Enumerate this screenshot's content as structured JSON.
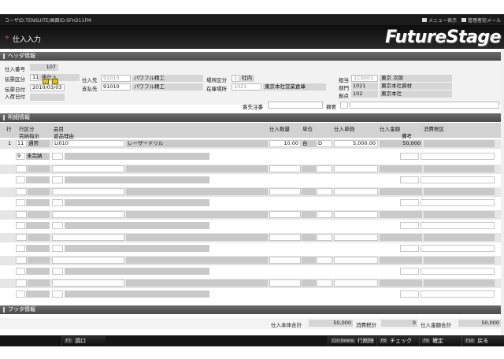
{
  "topbar": {
    "user_info": "ユーザID:TENSUITE/画面ID:SFH211FM",
    "menu_label": "メニュー表示",
    "admin_mail_label": "管理者宛メール"
  },
  "titlebar": {
    "title": "仕入入力",
    "brand": "FutureStage"
  },
  "header_section": {
    "title": "ヘッダ情報",
    "slip_no_label": "仕入番号",
    "slip_no": "107",
    "slip_type_label": "伝票区分",
    "slip_type_code": "11",
    "slip_type_name": "掛仕入",
    "slip_date_label": "伝票日付",
    "slip_date": "2010/03/03",
    "arrival_date_label": "入荷日付",
    "supplier_label": "仕入先",
    "supplier_code": "91010",
    "supplier_name": "パワフル精工",
    "payee_label": "支払先",
    "payee_code": "91010",
    "payee_name": "パワフル精工",
    "place_type_label": "場所区分",
    "place_type_code": "1",
    "place_type_name": "社内",
    "location_label": "在庫場所",
    "location_code": "1021",
    "location_name": "東京本社営業倉庫",
    "staff_label": "担当",
    "staff_code": "1C0001",
    "staff_name": "東京 次郎",
    "dept_label": "部門",
    "dept_code": "1021",
    "dept_name": "東京本社資材",
    "base_label": "拠点",
    "base_code": "102",
    "base_name": "東京本社",
    "customer_order_label": "客先注番",
    "summary_label": "摘要"
  },
  "detail_section": {
    "title": "明細情報",
    "headers": {
      "line": "行",
      "line_type": "行区分",
      "item": "品目",
      "qty": "仕入数量",
      "unit": "単位",
      "unit_price": "仕入単価",
      "amount": "仕入金額",
      "tax_type": "消費税区",
      "complete_flag": "完納指示",
      "return_reason": "返品理由",
      "note": "備考"
    },
    "row1": {
      "line": "1",
      "type_code": "11",
      "type_name": "通常",
      "item_code": "LI010",
      "item_name": "レーザードリル",
      "qty": "10.00",
      "unit": "台",
      "tax": "D",
      "unit_price": "5,000.00",
      "amount": "50,000",
      "complete_code": "9",
      "complete_name": "未完納"
    }
  },
  "footer_section": {
    "title": "フッタ情報",
    "subtotal_label": "仕入本体合計",
    "subtotal": "50,000",
    "tax_label": "消費税計",
    "tax": "0",
    "total_label": "仕入金額合計",
    "total": "50,000"
  },
  "fkeys": {
    "f7_key": "F7",
    "f7_label": "請口",
    "delete_key": "Ctrl Delete",
    "delete_label": "行削除",
    "f8_key": "F8",
    "f8_label": "チェック",
    "f9_key": "F9",
    "f9_label": "確定",
    "f10_key": "F10",
    "f10_label": "戻る"
  },
  "colors": {
    "accent_red": "#ff5a5a",
    "header_dark": "#1b1b1b",
    "section_gray": "#5a5a5a"
  }
}
